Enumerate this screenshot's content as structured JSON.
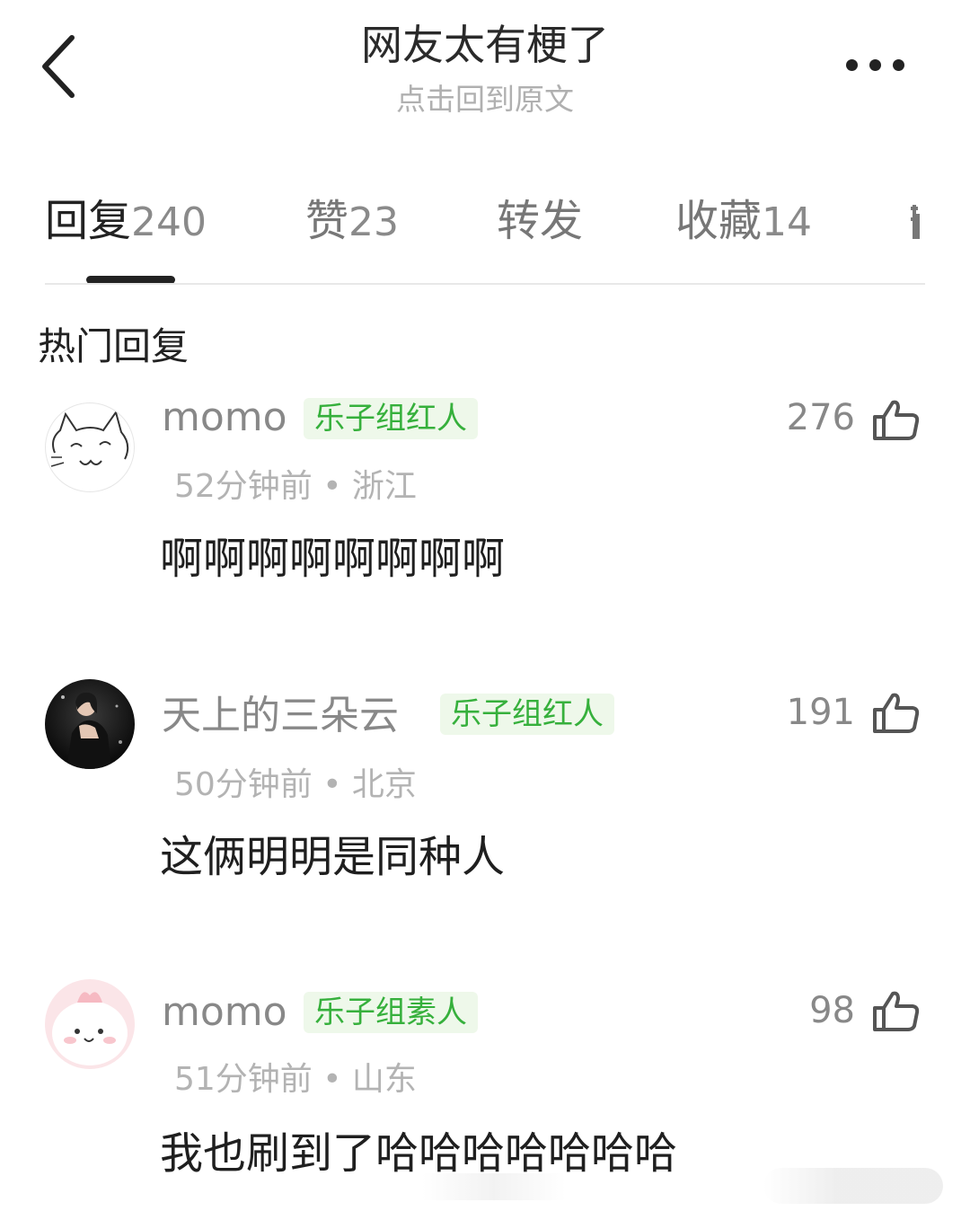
{
  "header": {
    "title": "网友太有梗了",
    "subtitle": "点击回到原文"
  },
  "tabs": [
    {
      "label": "回复",
      "count": "240",
      "active": true
    },
    {
      "label": "赞",
      "count": "23",
      "active": false
    },
    {
      "label": "转发",
      "count": "",
      "active": false
    },
    {
      "label": "收藏",
      "count": "14",
      "active": false
    }
  ],
  "section_title": "热门回复",
  "comments": [
    {
      "username": "momo",
      "badge": "乐子组红人",
      "meta": "52分钟前 • 浙江",
      "text": "啊啊啊啊啊啊啊啊",
      "likes": "276",
      "avatar": "cat-sketch-avatar"
    },
    {
      "username": "天上的三朵云",
      "badge": "乐子组红人",
      "meta": "50分钟前 • 北京",
      "text": "这俩明明是同种人",
      "likes": "191",
      "avatar": "photo-avatar"
    },
    {
      "username": "momo",
      "badge": "乐子组素人",
      "meta": "51分钟前 • 山东",
      "text": "我也刷到了哈哈哈哈哈哈哈",
      "likes": "98",
      "avatar": "pink-blob-avatar"
    }
  ],
  "colors": {
    "badge_text": "#36b03c",
    "badge_bg": "#eef8ea",
    "muted": "#b3b3b3",
    "indicator": "#222222"
  }
}
